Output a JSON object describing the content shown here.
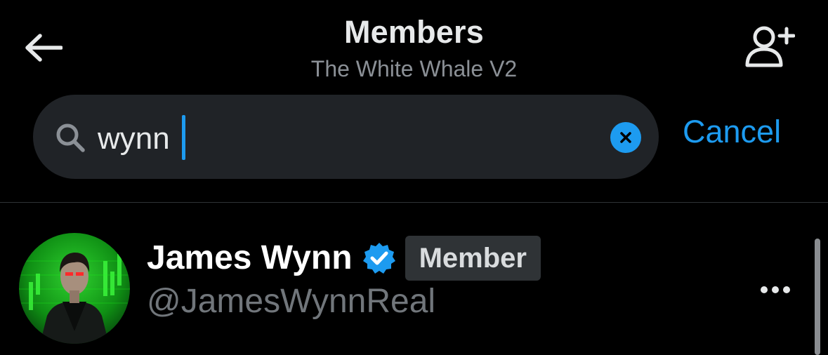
{
  "header": {
    "title": "Members",
    "subtitle": "The White Whale V2",
    "back_icon": "arrow-left-icon",
    "add_icon": "add-person-icon"
  },
  "search": {
    "value": "wynn",
    "icon": "search-icon",
    "clear_icon": "clear-icon",
    "cancel_label": "Cancel"
  },
  "results": [
    {
      "name": "James Wynn",
      "handle": "@JamesWynnReal",
      "verified": true,
      "role_badge": "Member"
    }
  ],
  "colors": {
    "background": "#000000",
    "accent": "#1d9bf0",
    "search_bg": "#202327",
    "badge_bg": "#2f3336",
    "secondary_text": "#71767b"
  }
}
